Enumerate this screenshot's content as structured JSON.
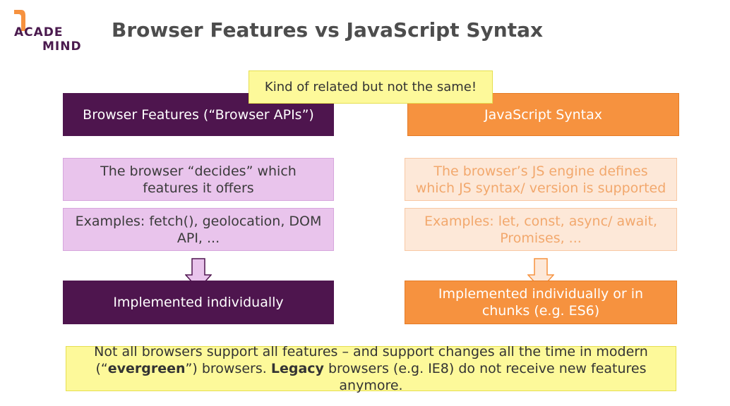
{
  "logo": {
    "line1": "ACADE",
    "line2": "MIND"
  },
  "title": "Browser Features vs JavaScript Syntax",
  "callout": "Kind of related but not the same!",
  "left": {
    "header": "Browser Features (“Browser APIs”)",
    "box1": "The browser “decides” which features it offers",
    "box2": "Examples: fetch(), geolocation, DOM API, ...",
    "result": "Implemented individually"
  },
  "right": {
    "header": "JavaScript Syntax",
    "box1": "The browser’s JS engine defines which JS syntax/ version is supported",
    "box2": "Examples: let, const, async/ await, Promises, ...",
    "result": "Implemented individually or in chunks (e.g. ES6)"
  },
  "footer": {
    "part1": "Not all browsers support all features – and support changes all the time in modern (“",
    "bold1": "evergreen",
    "part2": "”) browsers. ",
    "bold2": "Legacy",
    "part3": " browsers (e.g. IE8) do not receive new features anymore."
  },
  "colors": {
    "dark_purple": "#4e154e",
    "light_purple": "#e9c4ec",
    "orange": "#f6923f",
    "light_orange": "#fde8d8",
    "yellow": "#fdf99a"
  }
}
